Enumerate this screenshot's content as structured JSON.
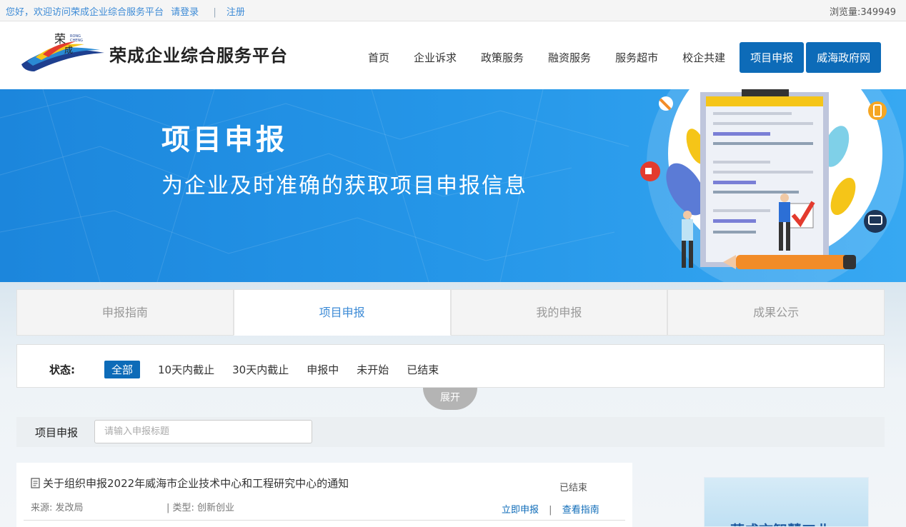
{
  "topbar": {
    "welcome": "您好，欢迎访问荣成企业综合服务平台",
    "login": "请登录",
    "separator": "|",
    "register": "注册",
    "views": "浏览量:349949"
  },
  "header": {
    "site_title": "荣成企业综合服务平台",
    "nav": [
      {
        "label": "首页"
      },
      {
        "label": "企业诉求"
      },
      {
        "label": "政策服务"
      },
      {
        "label": "融资服务"
      },
      {
        "label": "服务超市"
      },
      {
        "label": "校企共建"
      }
    ],
    "btn_project": "项目申报",
    "btn_weihai": "威海政府网"
  },
  "banner": {
    "title": "项目申报",
    "subtitle": "为企业及时准确的获取项目申报信息"
  },
  "tabs": [
    {
      "label": "申报指南",
      "active": false
    },
    {
      "label": "项目申报",
      "active": true
    },
    {
      "label": "我的申报",
      "active": false
    },
    {
      "label": "成果公示",
      "active": false
    }
  ],
  "filter": {
    "label": "状态:",
    "options": [
      "全部",
      "10天内截止",
      "30天内截止",
      "申报中",
      "未开始",
      "已结束"
    ],
    "active_index": 0,
    "expand_label": "展开"
  },
  "search": {
    "label": "项目申报",
    "placeholder": "请输入申报标题"
  },
  "list": [
    {
      "title": "关于组织申报2022年威海市企业技术中心和工程研究中心的通知",
      "status": "已结束",
      "source": "来源:  发改局",
      "type": "|  类型:  创新创业",
      "action_apply": "立即申报",
      "action_sep": "|",
      "action_guide": "查看指南"
    }
  ],
  "side": {
    "text": "荣成市智慧工业"
  },
  "colors": {
    "primary": "#0d6bb8",
    "link": "#3d8bd6",
    "banner": "#2596e8"
  }
}
